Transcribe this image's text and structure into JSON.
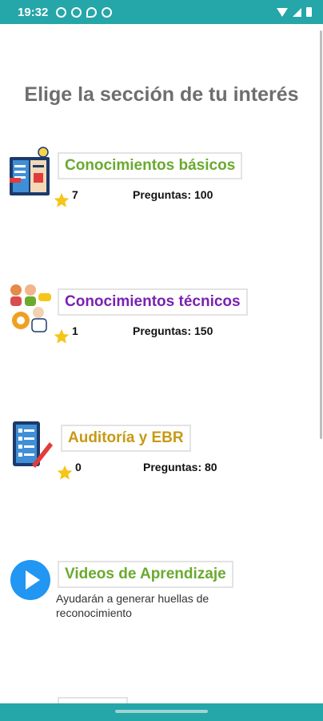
{
  "status_bar": {
    "time": "19:32",
    "left_icons": [
      "whatsapp-icon",
      "whatsapp-icon",
      "location-icon",
      "notification-icon"
    ],
    "right_icons": [
      "wifi-icon",
      "signal-icon",
      "battery-icon"
    ]
  },
  "page": {
    "title": "Elige la sección de tu interés"
  },
  "colors": {
    "accent": "#25a6a8",
    "green": "#6aaa2e",
    "purple": "#7a22b0",
    "gold": "#c79a14",
    "star": "#f5c518"
  },
  "sections": [
    {
      "title": "Conocimientos básicos",
      "icon": "book-lightbulb-icon",
      "count": "7",
      "questions": "Preguntas: 100"
    },
    {
      "title": "Conocimientos técnicos",
      "icon": "team-gear-icon",
      "count": "1",
      "questions": "Preguntas: 150"
    },
    {
      "title": "Auditoría y EBR",
      "icon": "checklist-icon",
      "count": "0",
      "questions": "Preguntas: 80"
    },
    {
      "title": "Videos de Aprendizaje",
      "icon": "play-icon",
      "description": "Ayudarán a generar huellas de reconocimiento"
    }
  ]
}
